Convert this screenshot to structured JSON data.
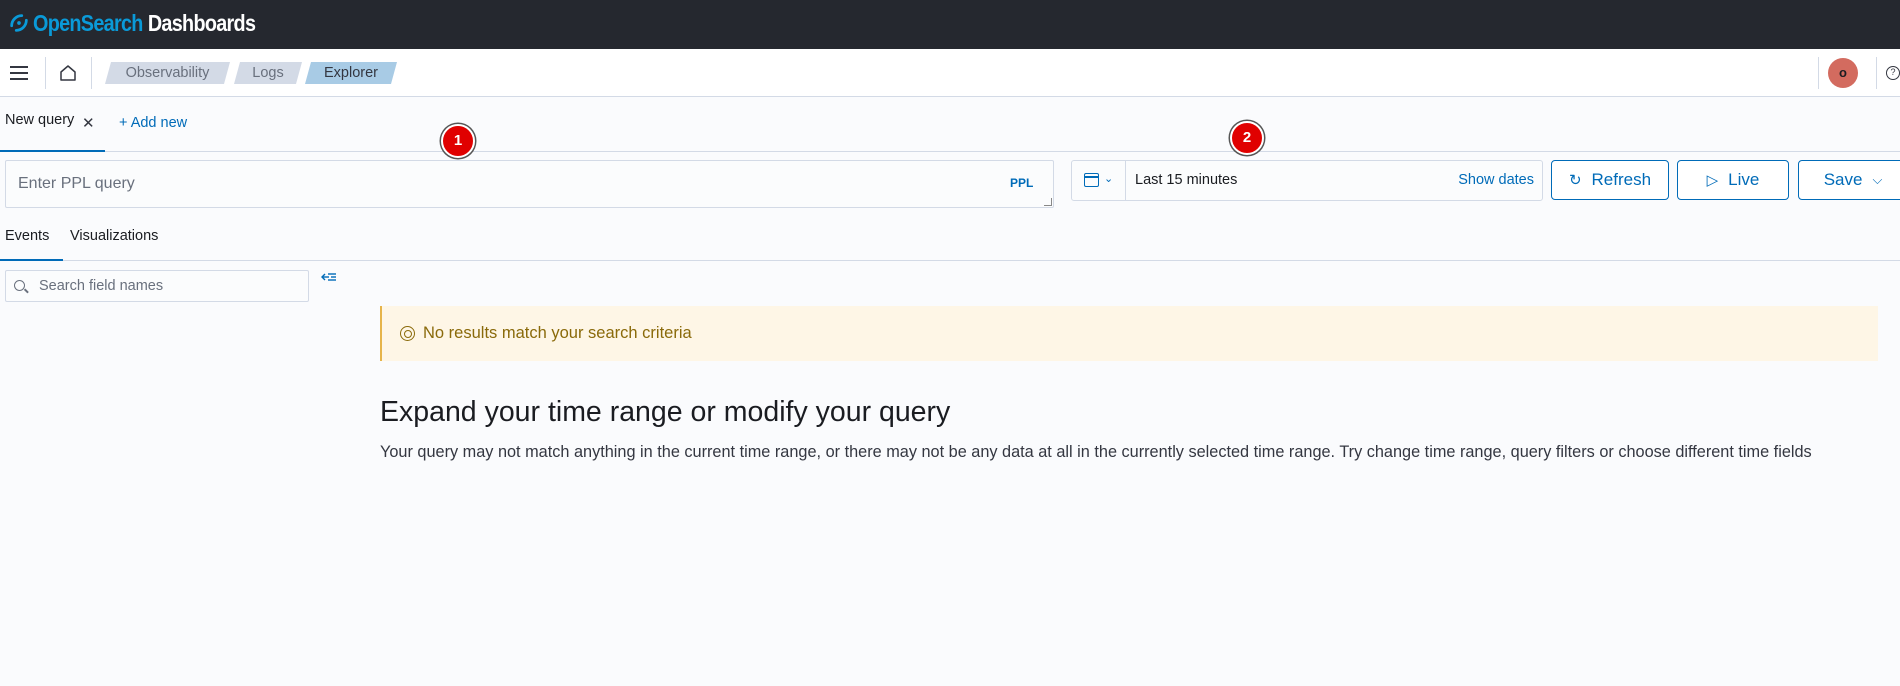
{
  "header": {
    "logo_open": "Open",
    "logo_search": "Search",
    "logo_dashboards": "Dashboards"
  },
  "breadcrumbs": [
    "Observability",
    "Logs",
    "Explorer"
  ],
  "user": {
    "avatar_initial": "o"
  },
  "query_tabs": {
    "active_label": "New query",
    "add_new_label": "+ Add new"
  },
  "markers": [
    "1",
    "2"
  ],
  "query": {
    "placeholder": "Enter PPL query",
    "value": "",
    "language_badge": "PPL"
  },
  "date_picker": {
    "range_label": "Last 15 minutes",
    "show_dates_label": "Show dates"
  },
  "actions": {
    "refresh_label": "Refresh",
    "live_label": "Live",
    "save_label": "Save"
  },
  "view_tabs": [
    "Events",
    "Visualizations"
  ],
  "sidebar": {
    "search_placeholder": "Search field names"
  },
  "callout": {
    "text": "No results match your search criteria"
  },
  "empty_state": {
    "title": "Expand your time range or modify your query",
    "body": "Your query may not match anything in the current time range, or there may not be any data at all in the currently selected time range. Try change time range, query filters or choose different time fields"
  },
  "colors": {
    "header_bg": "#25282f",
    "accent": "#006bb8",
    "callout_bg": "#fef6e6",
    "callout_text": "#8a6a0a",
    "marker": "#e00000",
    "avatar_bg": "#d36b5f"
  }
}
